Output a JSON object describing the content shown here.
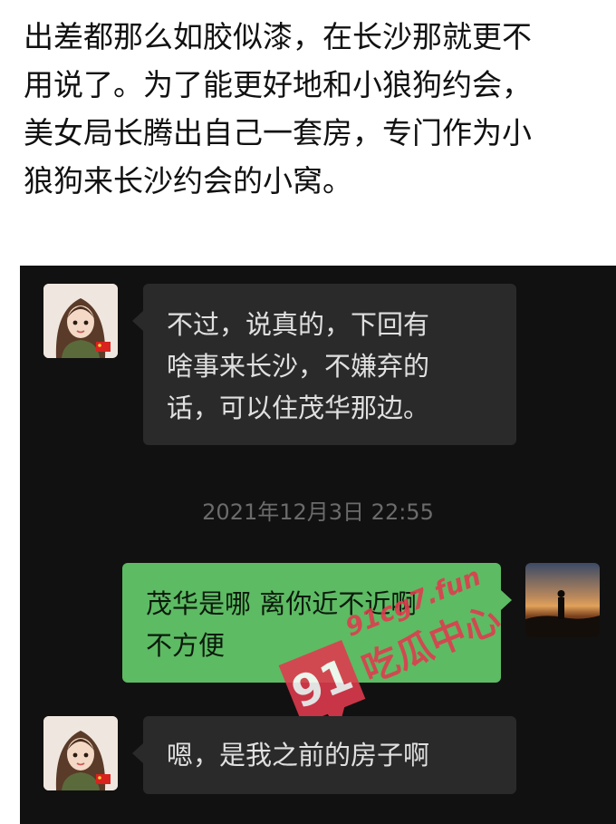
{
  "article": {
    "lines": [
      "出差都那么如胶似漆，在长沙那就更不",
      "用说了。为了能更好地和小狼狗约会，",
      "美女局长腾出自己一套房，专门作为小",
      "狼狗来长沙约会的小窝。"
    ]
  },
  "chat": {
    "messages": [
      {
        "side": "left",
        "text": "不过，说真的，下回有\n啥事来长沙，不嫌弃的\n话，可以住茂华那边。"
      },
      {
        "side": "right",
        "text": "茂华是哪 离你近不近啊\n不方便"
      },
      {
        "side": "left",
        "text": "嗯，是我之前的房子啊"
      }
    ],
    "timestamp": "2021年12月3日 22:55"
  },
  "watermark": {
    "domain": "91cg7.fun",
    "brand": "吃瓜中心",
    "badge": "91"
  }
}
